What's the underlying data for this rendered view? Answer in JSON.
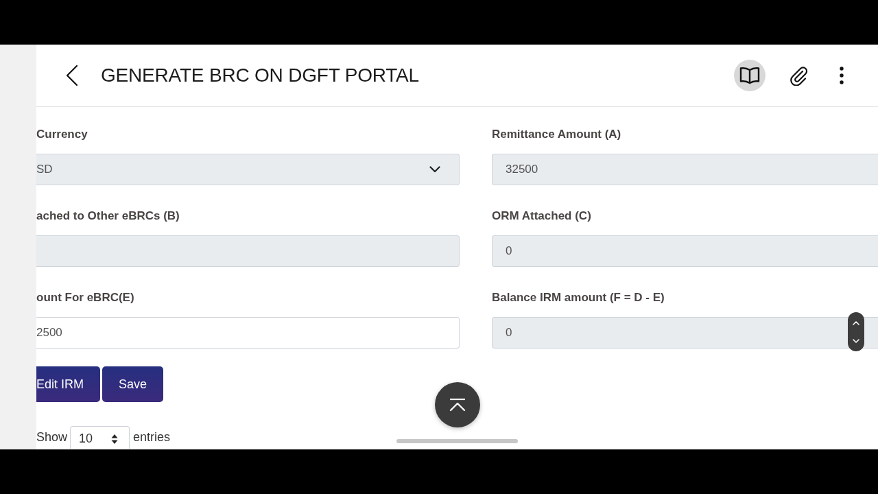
{
  "header": {
    "title": "GENERATE BRC ON DGFT PORTAL",
    "actions": [
      {
        "kind": "book",
        "active": true
      },
      {
        "kind": "paperclip",
        "active": false
      },
      {
        "kind": "more",
        "active": false
      }
    ]
  },
  "form": {
    "fields": [
      {
        "label": "Currency",
        "kind": "select",
        "value": "SD",
        "disabled": true
      },
      {
        "label": "Remittance Amount (A)",
        "kind": "text",
        "value": "32500",
        "disabled": true
      },
      {
        "label": "ached to Other eBRCs (B)",
        "kind": "text",
        "disabled": true
      },
      {
        "label": "ORM Attached (C)",
        "kind": "text",
        "value": "0",
        "disabled": true
      },
      {
        "label": "ount For eBRC(E)",
        "kind": "text",
        "value": "2500",
        "disabled": false
      },
      {
        "label": "Balance IRM amount (F = D - E)",
        "kind": "text",
        "value": "0",
        "disabled": true
      }
    ]
  },
  "buttons": [
    "Edit IRM",
    "Save"
  ],
  "entries": {
    "prefix": "Show",
    "page_size": "10",
    "suffix": "entries"
  }
}
